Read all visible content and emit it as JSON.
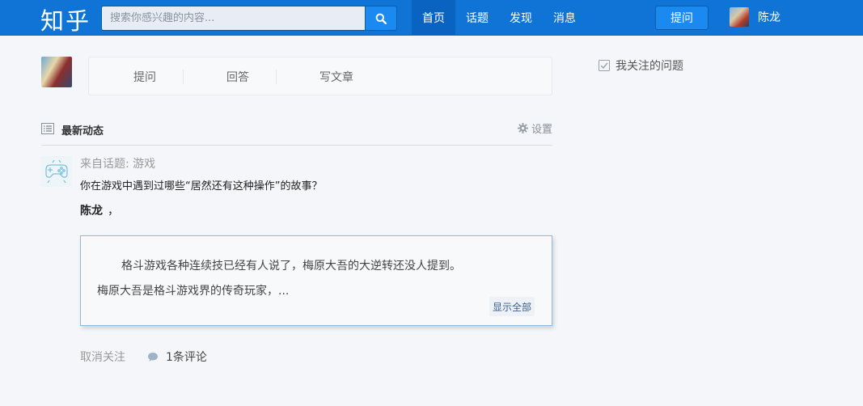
{
  "header": {
    "logo": "知乎",
    "search_placeholder": "搜索你感兴趣的内容...",
    "nav": [
      {
        "label": "首页",
        "active": true
      },
      {
        "label": "话题",
        "active": false
      },
      {
        "label": "发现",
        "active": false
      },
      {
        "label": "消息",
        "active": false
      }
    ],
    "ask_label": "提问",
    "user_name": "陈龙"
  },
  "composer": {
    "items": [
      "提问",
      "回答",
      "写文章"
    ]
  },
  "feed": {
    "title": "最新动态",
    "settings_label": "设置",
    "item": {
      "source_prefix": "来自话题: ",
      "topic": "游戏",
      "question": "你在游戏中遇到过哪些“居然还有这种操作”的故事？",
      "author": "陈龙",
      "author_suffix": "，",
      "excerpt_line1": "格斗游戏各种连续技已经有人说了，梅原大吾的大逆转还没人提到。",
      "excerpt_line2": "梅原大吾是格斗游戏界的传奇玩家，...",
      "show_all": "显示全部",
      "unfollow": "取消关注",
      "comments": "1条评论"
    }
  },
  "sidebar": {
    "followed_questions": "我关注的问题"
  },
  "colors": {
    "brand": "#0f74d6",
    "button": "#1a8af0",
    "background": "#f4f6f9"
  }
}
